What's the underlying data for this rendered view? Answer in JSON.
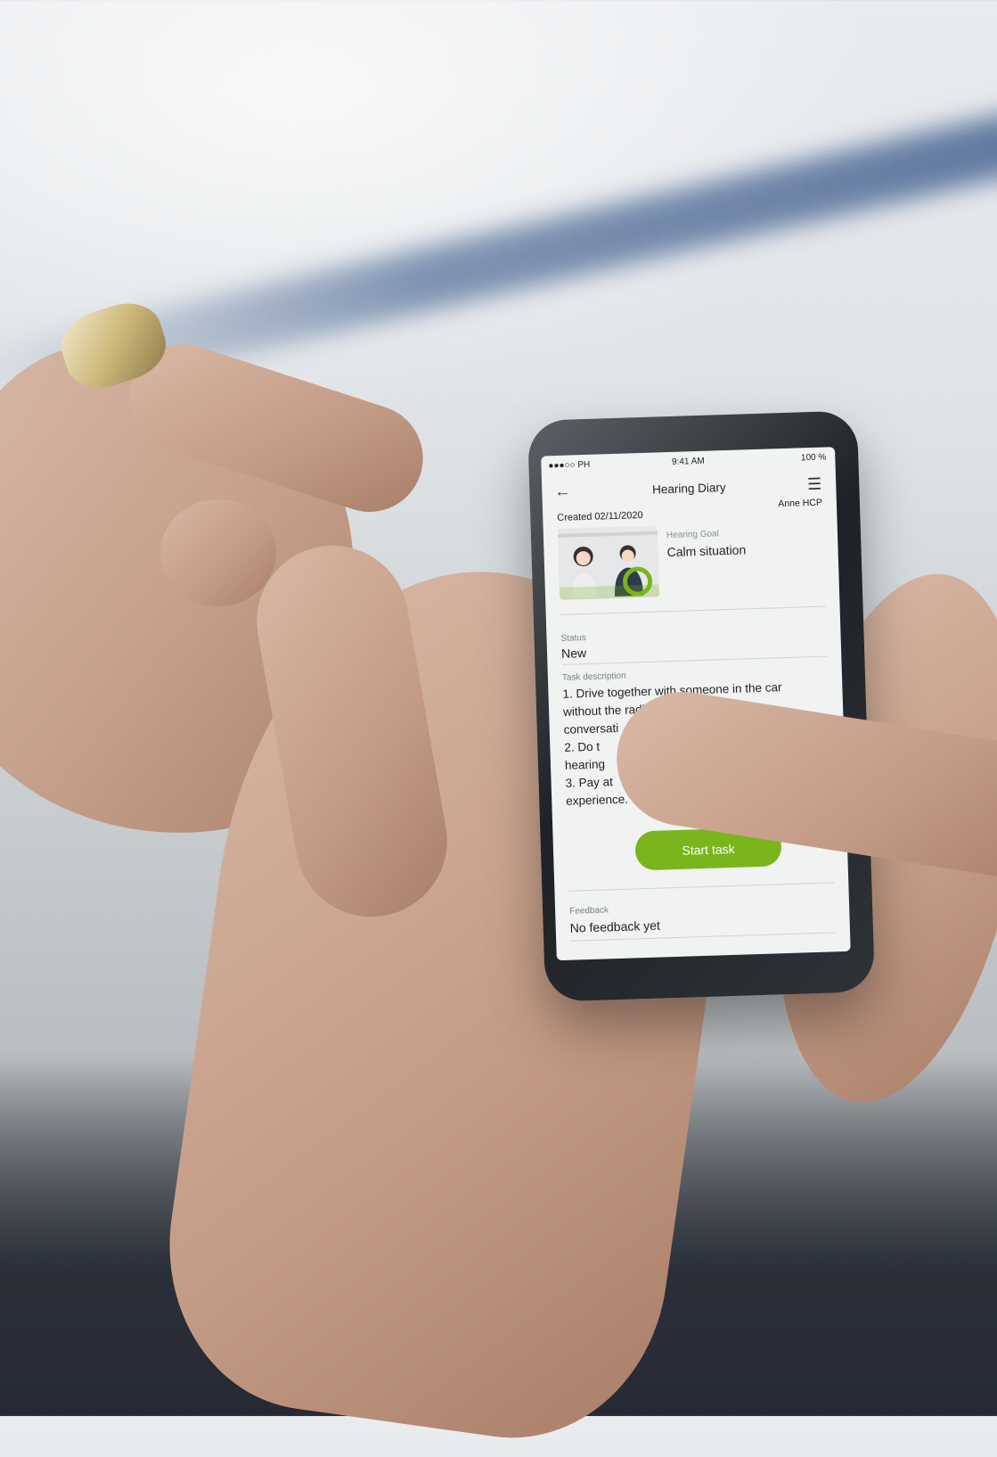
{
  "status_bar": {
    "carrier": "●●●○○ PH",
    "time": "9:41 AM",
    "battery": "100 %"
  },
  "header": {
    "title": "Hearing Diary",
    "back_icon": "←",
    "menu_icon": "☰"
  },
  "meta": {
    "created": "Created 02/11/2020",
    "author": "Anne HCP"
  },
  "goal": {
    "label": "Hearing Goal",
    "value": "Calm situation"
  },
  "status": {
    "label": "Status",
    "value": "New"
  },
  "task": {
    "label": "Task description",
    "lines": [
      "1. Drive together with someone in the car",
      "without the radio on and have a",
      "conversati",
      "2. Do t",
      "hearing",
      "3. Pay at",
      "experience."
    ]
  },
  "actions": {
    "start_label": "Start task"
  },
  "feedback": {
    "label": "Feedback",
    "value": "No feedback yet"
  },
  "colors": {
    "accent": "#7ab51d"
  }
}
